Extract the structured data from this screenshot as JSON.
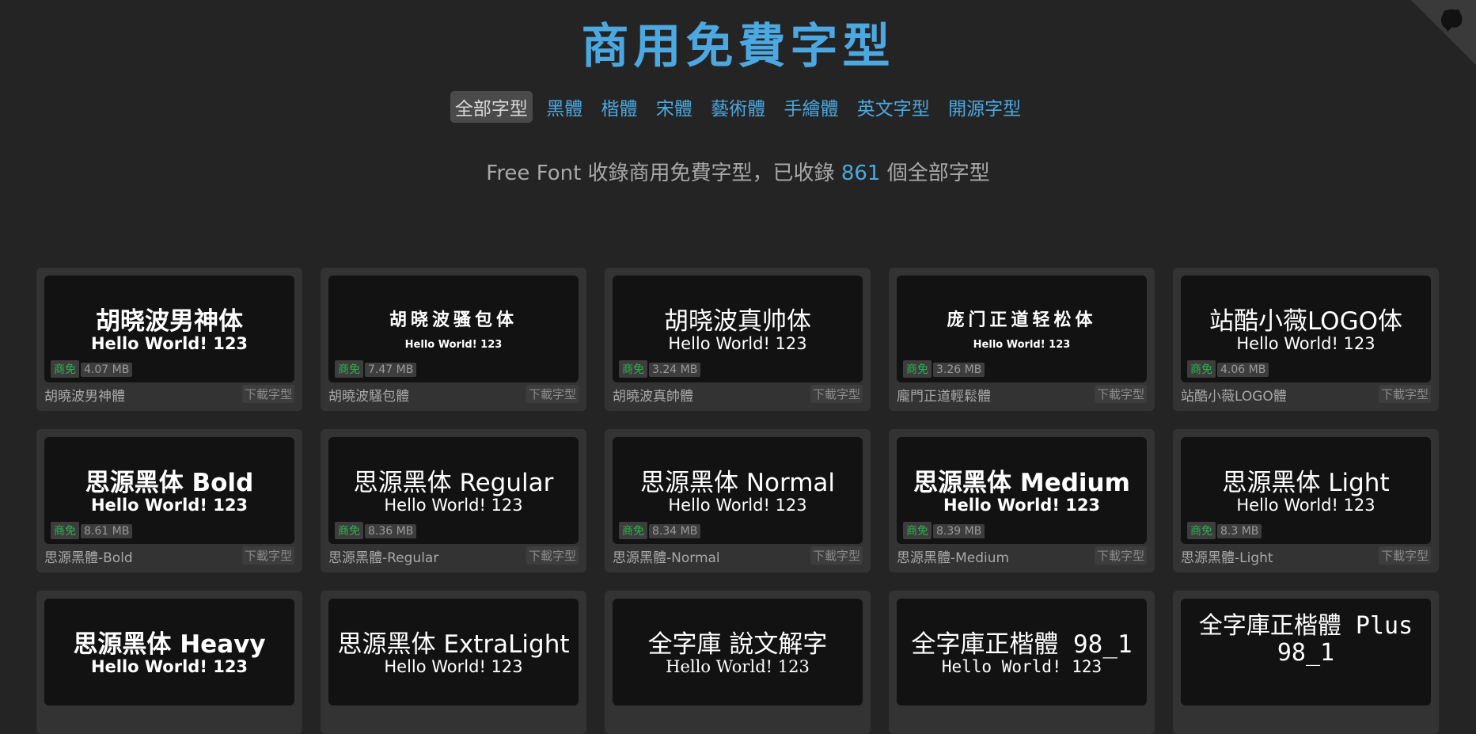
{
  "title": "商用免費字型",
  "nav": [
    "全部字型",
    "黑體",
    "楷體",
    "宋體",
    "藝術體",
    "手繪體",
    "英文字型",
    "開源字型"
  ],
  "subtitle": {
    "prefix": "Free Font 收錄商用免費字型，已收錄",
    "count": "861",
    "suffix": "個全部字型"
  },
  "download_label": "下載字型",
  "accent_color": "#4ba8e0",
  "license_color": "#28b44a",
  "fonts": [
    {
      "preview": "胡晓波男神体",
      "sample": "Hello World! 123",
      "license": "商免",
      "size": "4.07 MB",
      "name": "胡曉波男神體"
    },
    {
      "preview": "胡晓波骚包体",
      "sample": "Hello World! 123",
      "license": "商免",
      "size": "7.47 MB",
      "name": "胡曉波騷包體"
    },
    {
      "preview": "胡晓波真帅体",
      "sample": "Hello World! 123",
      "license": "商免",
      "size": "3.24 MB",
      "name": "胡曉波真帥體"
    },
    {
      "preview": "庞门正道轻松体",
      "sample": "Hello World! 123",
      "license": "商免",
      "size": "3.26 MB",
      "name": "龐門正道輕鬆體"
    },
    {
      "preview": "站酷小薇LOGO体",
      "sample": "Hello World! 123",
      "license": "商免",
      "size": "4.06 MB",
      "name": "站酷小薇LOGO體"
    },
    {
      "preview": "思源黑体 Bold",
      "sample": "Hello World! 123",
      "license": "商免",
      "size": "8.61 MB",
      "name": "思源黑體-Bold"
    },
    {
      "preview": "思源黑体 Regular",
      "sample": "Hello World! 123",
      "license": "商免",
      "size": "8.36 MB",
      "name": "思源黑體-Regular"
    },
    {
      "preview": "思源黑体 Normal",
      "sample": "Hello World! 123",
      "license": "商免",
      "size": "8.34 MB",
      "name": "思源黑體-Normal"
    },
    {
      "preview": "思源黑体 Medium",
      "sample": "Hello World! 123",
      "license": "商免",
      "size": "8.39 MB",
      "name": "思源黑體-Medium"
    },
    {
      "preview": "思源黑体 Light",
      "sample": "Hello World! 123",
      "license": "商免",
      "size": "8.3 MB",
      "name": "思源黑體-Light"
    },
    {
      "preview": "思源黑体 Heavy",
      "sample": "Hello World! 123"
    },
    {
      "preview": "思源黑体 ExtraLight",
      "sample": "Hello World! 123"
    },
    {
      "preview": "全字庫 說文解字",
      "sample": "Hello World! 123"
    },
    {
      "preview": "全字庫正楷體 98_1",
      "sample": "Hello World! 123"
    },
    {
      "preview": "全字庫正楷體 Plus 98_1",
      "sample": ""
    }
  ]
}
